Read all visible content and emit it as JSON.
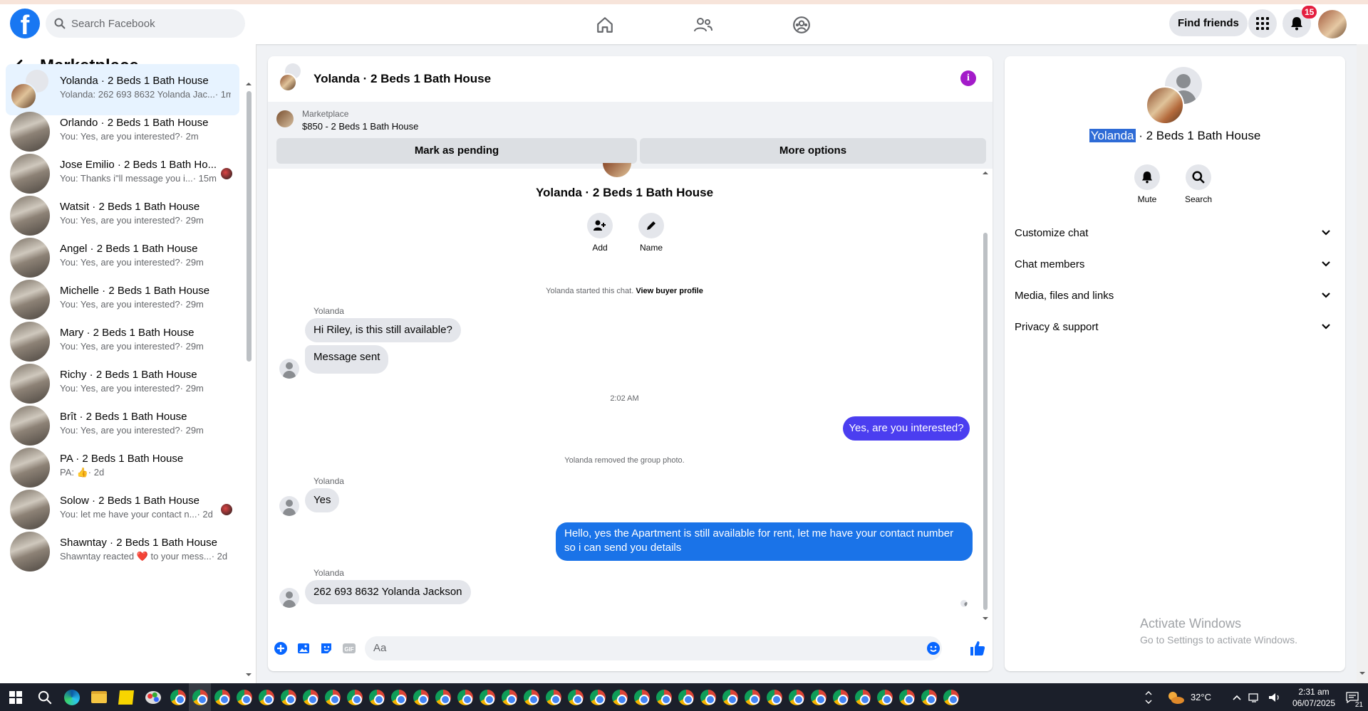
{
  "topbar": {
    "logo": "f",
    "search_placeholder": "Search Facebook",
    "nav_icons": [
      "home-icon",
      "friends-icon",
      "groups-icon"
    ],
    "find_friends": "Find friends",
    "notification_count": "15"
  },
  "sidebar": {
    "title": "Marketplace",
    "conversations": [
      {
        "name": "Yolanda · 2 Beds 1 Bath House",
        "preview": "Yolanda: 262 693 8632 Yolanda Jac...",
        "time": "· 1m"
      },
      {
        "name": "Orlando · 2 Beds 1 Bath House",
        "preview": "You: Yes, are you interested?",
        "time": "· 2m"
      },
      {
        "name": "Jose Emilio · 2 Beds 1 Bath Ho...",
        "preview": "You: Thanks i\"ll message you i...",
        "time": "· 15m"
      },
      {
        "name": "Watsit · 2 Beds 1 Bath House",
        "preview": "You: Yes, are you interested?",
        "time": "· 29m"
      },
      {
        "name": "Angel · 2 Beds 1 Bath House",
        "preview": "You: Yes, are you interested?",
        "time": "· 29m"
      },
      {
        "name": "Michelle · 2 Beds 1 Bath House",
        "preview": "You: Yes, are you interested?",
        "time": "· 29m"
      },
      {
        "name": "Mary · 2 Beds 1 Bath House",
        "preview": "You: Yes, are you interested?",
        "time": "· 29m"
      },
      {
        "name": "Richy · 2 Beds 1 Bath House",
        "preview": "You: Yes, are you interested?",
        "time": "· 29m"
      },
      {
        "name": "Brît · 2 Beds 1 Bath House",
        "preview": "You: Yes, are you interested?",
        "time": "· 29m"
      },
      {
        "name": "PA · 2 Beds 1 Bath House",
        "preview": "PA: 👍",
        "time": "· 2d"
      },
      {
        "name": "Solow · 2 Beds 1 Bath House",
        "preview": "You: let me have your contact n...",
        "time": "· 2d"
      },
      {
        "name": "Shawntay · 2 Beds 1 Bath House",
        "preview": "Shawntay reacted ❤️ to your mess...",
        "time": "· 2d"
      }
    ]
  },
  "chat": {
    "title": "Yolanda · 2 Beds 1 Bath House",
    "marketplace_label": "Marketplace",
    "listing": "$850 - 2 Beds 1 Bath House",
    "mark_pending": "Mark as pending",
    "more_options": "More options",
    "center_title": "Yolanda · 2 Beds 1 Bath House",
    "add_label": "Add",
    "name_label": "Name",
    "started_text": "Yolanda started this chat.",
    "view_profile": "View buyer profile",
    "sender": "Yolanda",
    "msg1": "Hi Riley, is this still available?",
    "msg2": "Message sent",
    "timestamp": "2:02 AM",
    "msg3": "Yes, are you interested?",
    "removed_photo": "Yolanda removed the group photo.",
    "msg4": "Yes",
    "msg5": "Hello, yes the Apartment is still available for rent, let me have your contact number so i can send you details",
    "msg6": "262 693 8632 Yolanda Jackson",
    "composer_placeholder": "Aa"
  },
  "details": {
    "title_highlight": "Yolanda",
    "title_rest": " · 2 Beds 1 Bath House",
    "mute": "Mute",
    "search": "Search",
    "sections": [
      "Customize chat",
      "Chat members",
      "Media, files and links",
      "Privacy & support"
    ]
  },
  "watermark": {
    "line1": "Activate Windows",
    "line2": "Go to Settings to activate Windows."
  },
  "taskbar": {
    "weather": "32°C",
    "time": "2:31 am",
    "date": "06/07/2025",
    "notif_count": "21"
  },
  "colors": {
    "brand": "#1877f2",
    "out_bubble": "#1a73e8",
    "purple_bubble": "#4b3ef0",
    "badge": "#e41e3f"
  }
}
